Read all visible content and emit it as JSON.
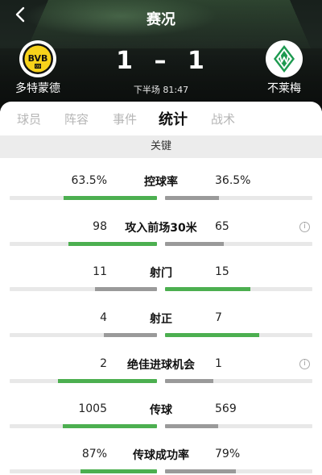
{
  "header": {
    "back_icon": "chevron-left-icon",
    "title": "赛况",
    "home_team": "多特蒙德",
    "away_team": "不莱梅",
    "score_home": "1",
    "score_sep": "–",
    "score_away": "1",
    "match_time": "下半场 81:47",
    "home_crest_text": "BVB",
    "home_crest_year": "09"
  },
  "tabs": [
    {
      "label": "球员",
      "active": false
    },
    {
      "label": "阵容",
      "active": false
    },
    {
      "label": "事件",
      "active": false
    },
    {
      "label": "统计",
      "active": true
    },
    {
      "label": "战术",
      "active": false
    }
  ],
  "section_title": "关键",
  "colors": {
    "winner": "#4caf50",
    "loser": "#9a9a9a",
    "track": "#e8e8e8",
    "bvb_yellow": "#f7d21b",
    "werder_green": "#1d9a50"
  },
  "stats": [
    {
      "label": "控球率",
      "home": "63.5%",
      "away": "36.5%",
      "home_share": 0.635,
      "away_share": 0.365,
      "info": false
    },
    {
      "label": "攻入前场30米",
      "home": "98",
      "away": "65",
      "home_share": 0.6,
      "away_share": 0.4,
      "info": true
    },
    {
      "label": "射门",
      "home": "11",
      "away": "15",
      "home_share": 0.42,
      "away_share": 0.58,
      "info": false
    },
    {
      "label": "射正",
      "home": "4",
      "away": "7",
      "home_share": 0.36,
      "away_share": 0.64,
      "info": false
    },
    {
      "label": "绝佳进球机会",
      "home": "2",
      "away": "1",
      "home_share": 0.67,
      "away_share": 0.33,
      "info": true
    },
    {
      "label": "传球",
      "home": "1005",
      "away": "569",
      "home_share": 0.64,
      "away_share": 0.36,
      "info": false
    },
    {
      "label": "传球成功率",
      "home": "87%",
      "away": "79%",
      "home_share": 0.52,
      "away_share": 0.48,
      "info": false
    }
  ]
}
